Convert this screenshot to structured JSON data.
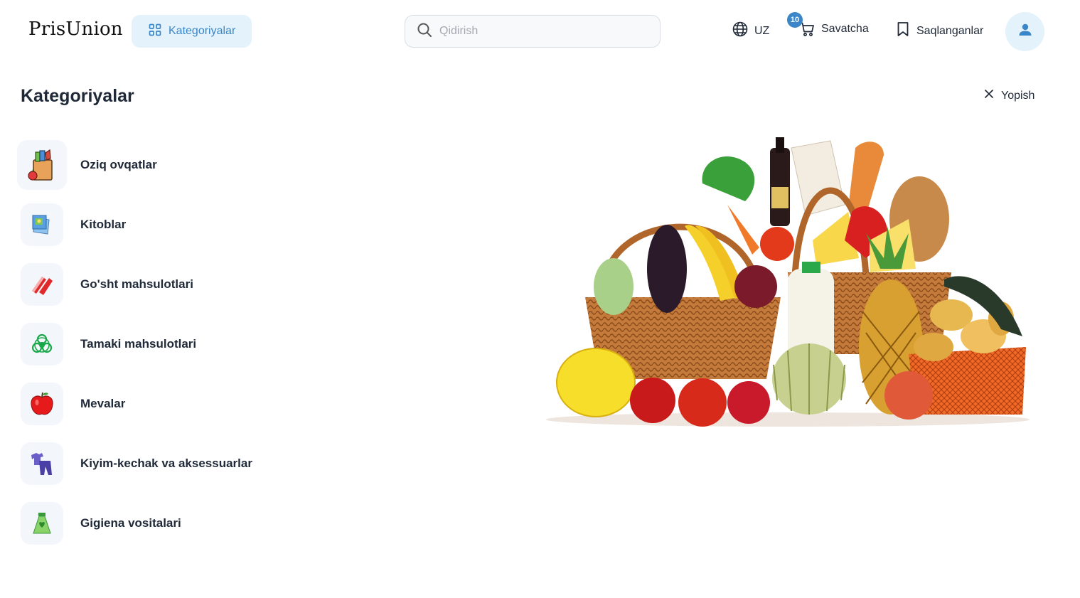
{
  "header": {
    "logo": "PrisUnion",
    "categories_button": "Kategoriyalar",
    "search_placeholder": "Qidirish",
    "language": "UZ",
    "cart_label": "Savatcha",
    "cart_count": "10",
    "saved_label": "Saqlanganlar"
  },
  "page": {
    "title": "Kategoriyalar",
    "close_label": "Yopish"
  },
  "categories": [
    {
      "label": "Oziq ovqatlar",
      "icon": "grocery-bag-icon"
    },
    {
      "label": "Kitoblar",
      "icon": "book-icon"
    },
    {
      "label": "Go'sht mahsulotlari",
      "icon": "meat-icon"
    },
    {
      "label": "Tamaki mahsulotlari",
      "icon": "biohazard-icon"
    },
    {
      "label": "Mevalar",
      "icon": "apple-icon"
    },
    {
      "label": "Kiyim-kechak va aksessuarlar",
      "icon": "clothes-icon"
    },
    {
      "label": "Gigiena vositalari",
      "icon": "hygiene-bottle-icon"
    }
  ],
  "colors": {
    "accent": "#3a86c8",
    "accent_bg": "#e3f2fb"
  }
}
